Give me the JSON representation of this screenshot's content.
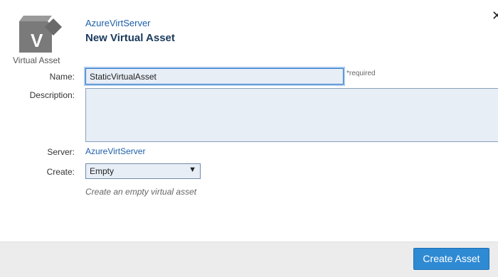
{
  "header": {
    "icon_name": "virtual-asset-icon",
    "icon_letter": "V",
    "icon_label": "Virtual Asset",
    "server_link": "AzureVirtServer",
    "title": "New Virtual Asset",
    "close_icon": "close-icon"
  },
  "form": {
    "name_label": "Name:",
    "name_value": "StaticVirtualAsset",
    "required_text": "*required",
    "description_label": "Description:",
    "description_value": "",
    "server_label": "Server:",
    "server_value": "AzureVirtServer",
    "create_label": "Create:",
    "create_selected": "Empty",
    "create_hint": "Create an empty virtual asset"
  },
  "footer": {
    "create_button": "Create Asset"
  },
  "colors": {
    "accent": "#2f8ad4",
    "link": "#1e5fa8",
    "title": "#1a3a5c",
    "footer_bg": "#ececec",
    "input_bg": "#e8eef6"
  }
}
